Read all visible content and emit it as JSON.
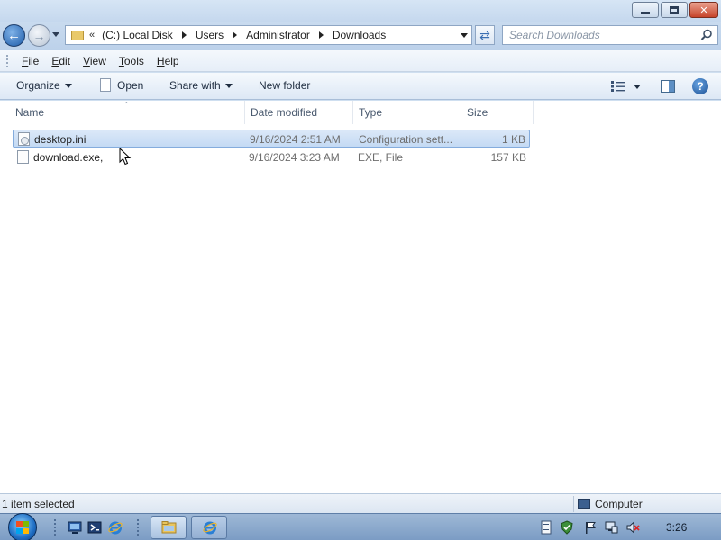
{
  "window": {
    "caption_buttons": [
      "minimize",
      "maximize",
      "close"
    ]
  },
  "address": {
    "overflow": "«",
    "crumbs": [
      "(C:) Local Disk",
      "Users",
      "Administrator",
      "Downloads"
    ]
  },
  "search": {
    "placeholder": "Search Downloads"
  },
  "menu": {
    "items": [
      {
        "accel": "F",
        "rest": "ile"
      },
      {
        "accel": "E",
        "rest": "dit"
      },
      {
        "accel": "V",
        "rest": "iew"
      },
      {
        "accel": "T",
        "rest": "ools"
      },
      {
        "accel": "H",
        "rest": "elp"
      }
    ]
  },
  "commands": {
    "organize": "Organize",
    "open": "Open",
    "share_with": "Share with",
    "new_folder": "New folder"
  },
  "columns": {
    "name": "Name",
    "date_modified": "Date modified",
    "type": "Type",
    "size": "Size"
  },
  "files": [
    {
      "name": "desktop.ini",
      "date": "9/16/2024 2:51 AM",
      "type": "Configuration sett...",
      "size": "1 KB",
      "selected": true
    },
    {
      "name": "download.exe,",
      "date": "9/16/2024 3:23 AM",
      "type": "EXE, File",
      "size": "157 KB",
      "selected": false
    }
  ],
  "status": {
    "selection": "1 item selected",
    "location": "Computer"
  },
  "taskbar": {
    "clock": "3:26"
  },
  "colors": {
    "selection_bg": "#c4daf4",
    "selection_border": "#84acdd",
    "taskbar": "#8aa9cf",
    "chrome": "#cfdff0"
  }
}
